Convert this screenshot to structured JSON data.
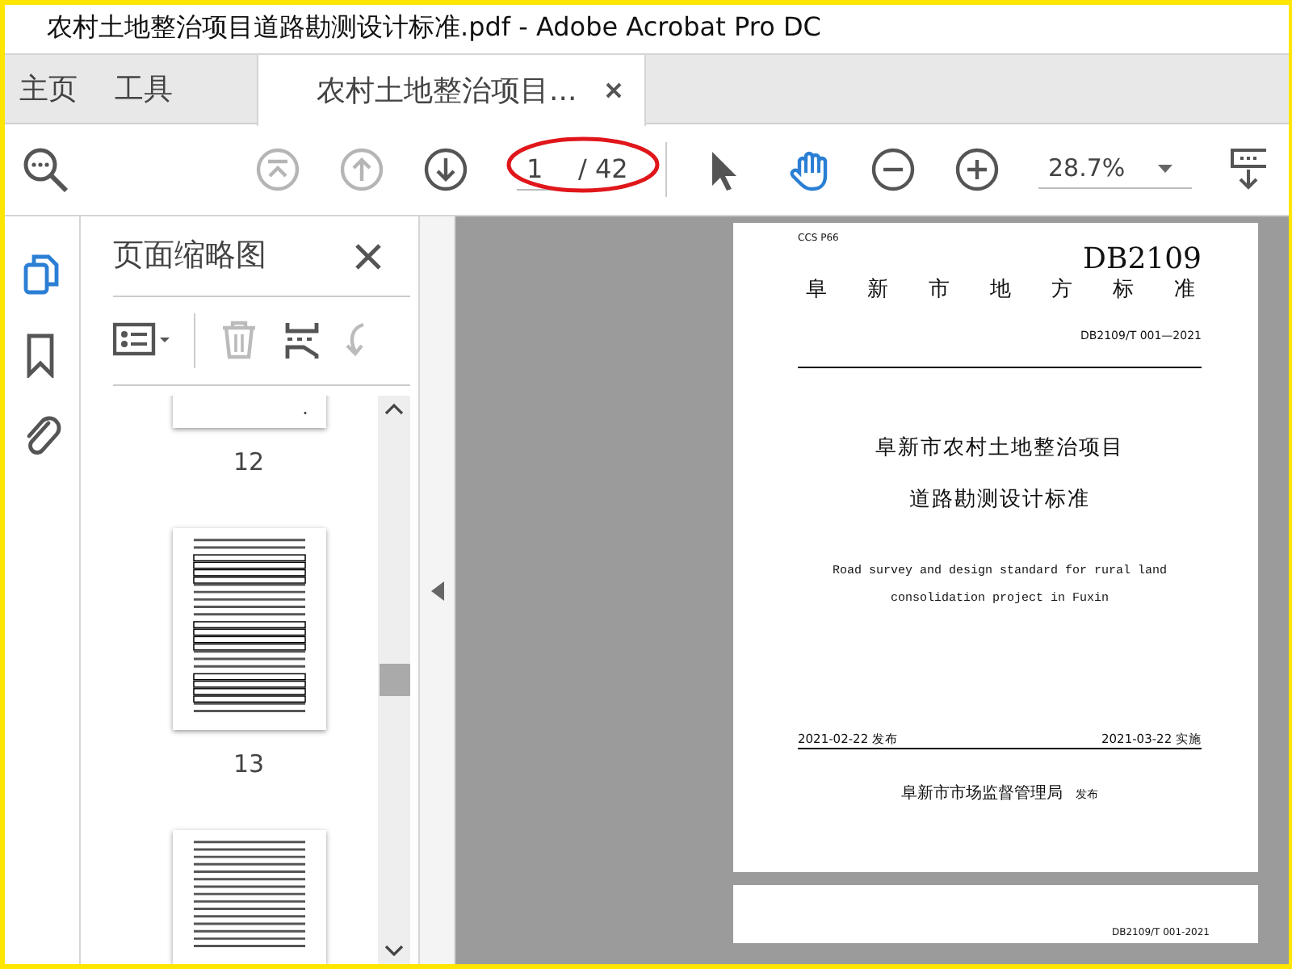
{
  "window": {
    "title": "农村土地整治项目道路勘测设计标准.pdf - Adobe Acrobat Pro DC"
  },
  "tabs": [
    {
      "label": "主页",
      "selected": false
    },
    {
      "label": "工具",
      "selected": false
    },
    {
      "label": "农村土地整治项目...",
      "selected": true
    }
  ],
  "toolbar": {
    "nav_buttons": [
      {
        "kind": "first-page",
        "disabled": true
      },
      {
        "kind": "prev-page",
        "disabled": true
      },
      {
        "kind": "next-page",
        "disabled": false
      }
    ],
    "page_input": "1",
    "page_total": "/ 42",
    "page_circled": true,
    "tool_buttons": [
      {
        "kind": "select",
        "selected": false
      },
      {
        "kind": "hand",
        "selected": true
      },
      {
        "kind": "zoom-out",
        "selected": false
      },
      {
        "kind": "zoom-in",
        "selected": false
      }
    ],
    "zoom": "28.7%"
  },
  "rail": [
    {
      "kind": "pages",
      "selected": true
    },
    {
      "kind": "bookmarks",
      "selected": false
    },
    {
      "kind": "attachments",
      "selected": false
    }
  ],
  "panel": {
    "title": "页面缩略图",
    "tools": [
      {
        "kind": "options",
        "disabled": false
      },
      {
        "kind": "delete",
        "disabled": true
      },
      {
        "kind": "insert",
        "disabled": false
      },
      {
        "kind": "undo",
        "disabled": true
      }
    ],
    "thumbnails": [
      {
        "kind": "top-cut",
        "label": "12"
      },
      {
        "kind": "full",
        "label": "13"
      },
      {
        "kind": "bottom-cut"
      }
    ]
  },
  "document": {
    "code": "CCS P66",
    "standard_id": "DB2109",
    "standard_type": "阜新市地方标准",
    "number": "DB2109/T 001—2021",
    "title_lines": [
      "阜新市农村土地整治项目",
      "道路勘测设计标准"
    ],
    "english_lines": [
      "Road survey and design standard for rural land",
      "consolidation project in Fuxin"
    ],
    "issue_date": "2021-02-22 发布",
    "effective_date": "2021-03-22 实施",
    "issuer": "阜新市市场监督管理局",
    "issuer_suffix": "发布",
    "next_page_footer": "DB2109/T 001-2021"
  }
}
